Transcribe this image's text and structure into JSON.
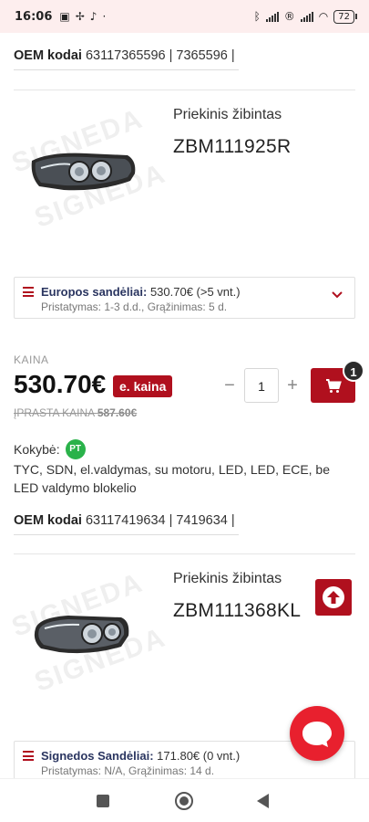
{
  "status_bar": {
    "time": "16:06",
    "battery": "72",
    "icons": [
      "message-icon",
      "pinwheel-icon",
      "tiktok-icon",
      "dot-icon",
      "bluetooth-icon",
      "signal-icon",
      "registered-icon",
      "signal-icon",
      "wifi-icon",
      "battery-icon"
    ]
  },
  "oem_top": {
    "label": "OEM kodai",
    "value": "63117365596 | 7365596 |"
  },
  "product1": {
    "type": "Priekinis žibintas",
    "code": "ZBM111925R",
    "stock_label": "Europos sandėliai:",
    "stock_value": "530.70€ (>5 vnt.)",
    "stock_details": "Pristatymas: 1-3 d.d., Grąžinimas: 5 d.",
    "price_label": "KAINA",
    "price": "530.70€",
    "eprice_badge": "e. kaina",
    "old_price_label": "ĮPRASTA KAINA",
    "old_price": "587.60€",
    "quantity": "1",
    "cart_badge": "1",
    "quality_label": "Kokybė:",
    "quality_badge": "PT",
    "description": "TYC, SDN, el.valdymas, su motoru, LED, LED, ECE, be LED valdymo blokelio",
    "oem_label": "OEM kodai",
    "oem_value": "63117419634 | 7419634 |"
  },
  "product2": {
    "type": "Priekinis žibintas",
    "code": "ZBM111368KL",
    "stock_label": "Signedos Sandėliai:",
    "stock_value": "171.80€ (0 vnt.)",
    "stock_details": "Pristatymas: N/A, Grąžinimas: 14 d."
  },
  "watermark": "SIGNEDA",
  "colors": {
    "brand": "#b0101e",
    "chat": "#e8202e",
    "quality_badge": "#2ab24a",
    "stock_label": "#2a3560"
  }
}
